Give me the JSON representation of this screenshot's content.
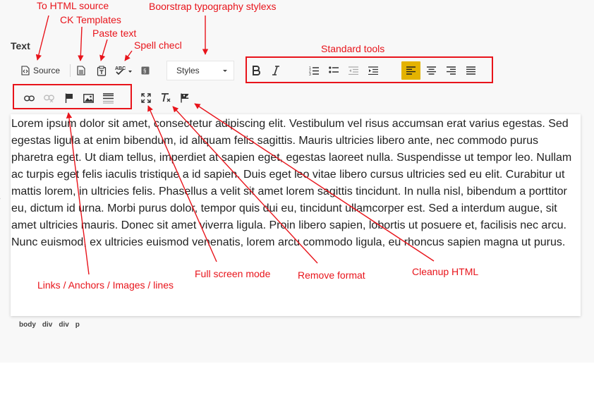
{
  "field_label": "Text",
  "toolbar": {
    "source_label": "Source",
    "styles_label": "Styles"
  },
  "editor": {
    "content": "Lorem ipsum dolor sit amet, consectetur adipiscing elit. Vestibulum vel risus accumsan erat varius egestas. Sed egestas ligula at enim bibendum, id aliquam felis sagittis. Mauris ultricies libero ante, nec commodo purus pharetra eget. Ut diam tellus, imperdiet at sapien eget, egestas laoreet nulla. Suspendisse ut tempor leo. Nullam ac turpis eget felis iaculis tristique a id sapien. Duis eget leo vitae libero cursus ultricies sed eu elit. Curabitur ut mattis lorem, in ultricies felis. Phasellus a velit sit amet lorem sagittis tincidunt. In nulla nisl, bibendum a porttitor eu, dictum id urna. Morbi purus dolor, tempor quis dui eu, tincidunt ullamcorper est. Sed a interdum augue, sit amet ultricies mauris. Donec sit amet viverra ligula. Proin libero sapien, lobortis ut posuere et, facilisis nec arcu. Nunc euismod, ex ultricies euismod venenatis, lorem arcu commodo ligula, eu rhoncus sapien magna ut purus."
  },
  "element_path": [
    "body",
    "div",
    "div",
    "p"
  ],
  "annotations": {
    "html_source": "To HTML source",
    "ck_templates": "CK Templates",
    "paste_text": "Paste text",
    "spell_check": "Spell checl",
    "bootstrap_styles": "Boorstrap typography stylexs",
    "standard_tools": "Standard tools",
    "links": "Links / Anchors / Images / lines",
    "full_screen": "Full screen mode",
    "remove_format": "Remove format",
    "cleanup_html": "Cleanup HTML"
  },
  "colors": {
    "annotation": "#e8141b",
    "active_alignment": "#e4b300"
  },
  "icons": [
    "source-icon",
    "templates-icon",
    "paste-text-icon",
    "spellcheck-icon",
    "scayt-icon",
    "bold-icon",
    "italic-icon",
    "numbered-list-icon",
    "bulleted-list-icon",
    "outdent-icon",
    "indent-icon",
    "align-left-icon",
    "align-center-icon",
    "align-right-icon",
    "justify-icon",
    "link-icon",
    "unlink-icon",
    "anchor-icon",
    "image-icon",
    "horizontal-line-icon",
    "maximize-icon",
    "remove-format-icon",
    "cleanup-html-icon"
  ]
}
